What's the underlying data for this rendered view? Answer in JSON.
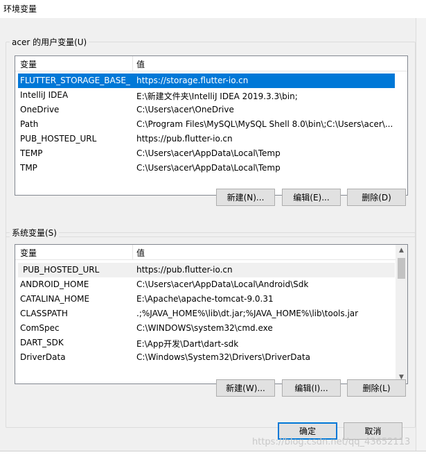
{
  "window": {
    "title": "环境变量"
  },
  "user_vars": {
    "group_label": "acer 的用户变量(U)",
    "col_var": "变量",
    "col_val": "值",
    "rows": [
      {
        "name": "FLUTTER_STORAGE_BASE_...",
        "value": "https://storage.flutter-io.cn"
      },
      {
        "name": "IntelliJ IDEA",
        "value": "E:\\新建文件夹\\IntelliJ IDEA 2019.3.3\\bin;"
      },
      {
        "name": "OneDrive",
        "value": "C:\\Users\\acer\\OneDrive"
      },
      {
        "name": "Path",
        "value": "C:\\Program Files\\MySQL\\MySQL Shell 8.0\\bin\\;C:\\Users\\acer\\..."
      },
      {
        "name": "PUB_HOSTED_URL",
        "value": "https://pub.flutter-io.cn"
      },
      {
        "name": "TEMP",
        "value": "C:\\Users\\acer\\AppData\\Local\\Temp"
      },
      {
        "name": "TMP",
        "value": "C:\\Users\\acer\\AppData\\Local\\Temp"
      }
    ],
    "new_label": "新建(N)...",
    "edit_label": "编辑(E)...",
    "delete_label": "删除(D)"
  },
  "system_vars": {
    "group_label": "系统变量(S)",
    "col_var": "变量",
    "col_val": "值",
    "rows": [
      {
        "name": "PUB_HOSTED_URL",
        "value": "https://pub.flutter-io.cn"
      },
      {
        "name": "ANDROID_HOME",
        "value": "C:\\Users\\acer\\AppData\\Local\\Android\\Sdk"
      },
      {
        "name": "CATALINA_HOME",
        "value": "E:\\Apache\\apache-tomcat-9.0.31"
      },
      {
        "name": "CLASSPATH",
        "value": ".;%JAVA_HOME%\\lib\\dt.jar;%JAVA_HOME%\\lib\\tools.jar"
      },
      {
        "name": "ComSpec",
        "value": "C:\\WINDOWS\\system32\\cmd.exe"
      },
      {
        "name": "DART_SDK",
        "value": "E:\\App开发\\Dart\\dart-sdk"
      },
      {
        "name": "DriverData",
        "value": "C:\\Windows\\System32\\Drivers\\DriverData"
      }
    ],
    "new_label": "新建(W)...",
    "edit_label": "编辑(I)...",
    "delete_label": "删除(L)"
  },
  "footer": {
    "ok_label": "确定",
    "cancel_label": "取消"
  },
  "watermark": "https://blog.csdn.net/qq_43652113"
}
